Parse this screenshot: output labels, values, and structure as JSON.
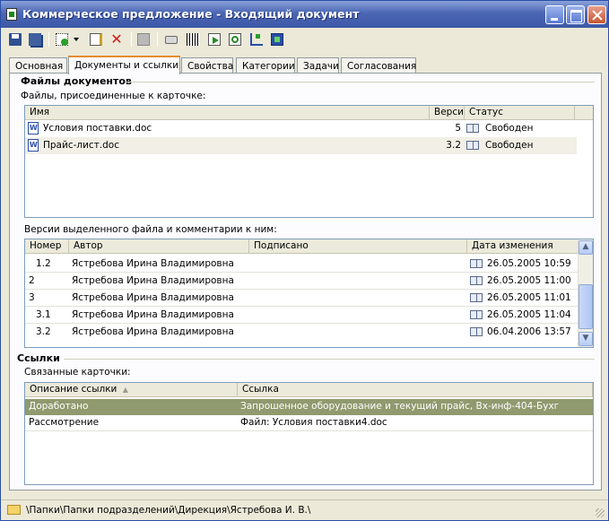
{
  "window": {
    "title": "Коммерческое предложение - Входящий документ",
    "titlebar_buttons": [
      "minimize",
      "maximize",
      "close"
    ]
  },
  "toolbar": {
    "icons": [
      "save-icon",
      "save-all-icon",
      "new-document-icon",
      "dropdown-arrow-icon",
      "properties-icon",
      "delete-icon",
      "sign-icon",
      "print-icon",
      "barcode-icon",
      "export-icon",
      "refresh-icon",
      "structure-icon",
      "workflow-icon"
    ]
  },
  "tabs": [
    {
      "label": "Основная"
    },
    {
      "label": "Документы и ссылки",
      "active": true
    },
    {
      "label": "Свойства"
    },
    {
      "label": "Категории"
    },
    {
      "label": "Задачи"
    },
    {
      "label": "Согласования"
    }
  ],
  "files_section": {
    "title": "Файлы документов",
    "label": "Файлы, присоединенные к карточке:",
    "columns": [
      "Имя",
      "Версия",
      "Статус"
    ],
    "rows": [
      {
        "name": "Условия поставки.doc",
        "version": "5",
        "status": "Свободен"
      },
      {
        "name": "Прайс-лист.doc",
        "version": "3.2",
        "status": "Свободен",
        "selected": true
      }
    ]
  },
  "versions_section": {
    "label": "Версии выделенного файла и комментарии к ним:",
    "columns": [
      "Номер",
      "Автор",
      "Подписано",
      "Дата изменения"
    ],
    "rows": [
      {
        "number": "1.2",
        "author": "Ястребова Ирина Владимировна",
        "signed": "",
        "date": "26.05.2005 10:59"
      },
      {
        "number": "2",
        "author": "Ястребова Ирина Владимировна",
        "signed": "",
        "date": "26.05.2005 11:00"
      },
      {
        "number": "3",
        "author": "Ястребова Ирина Владимировна",
        "signed": "",
        "date": "26.05.2005 11:01"
      },
      {
        "number": "3.1",
        "author": "Ястребова Ирина Владимировна",
        "signed": "",
        "date": "26.05.2005 11:04"
      },
      {
        "number": "3.2",
        "author": "Ястребова Ирина Владимировна",
        "signed": "",
        "date": "06.04.2006 13:57"
      }
    ]
  },
  "links_section": {
    "title": "Ссылки",
    "label": "Связанные карточки:",
    "columns": [
      "Описание ссылки",
      "Ссылка"
    ],
    "sort_indicator": "▲",
    "rows": [
      {
        "description": "Доработано",
        "link": "Запрошенное оборудование и текущий прайс, Вх-инф-404-Бухг",
        "selected": true
      },
      {
        "description": "Рассмотрение",
        "link": "Файл: Условия поставки4.doc"
      }
    ]
  },
  "statusbar": {
    "path": "\\Папки\\Папки подразделений\\Дирекция\\Ястребова И. В.\\"
  },
  "colors": {
    "titlebar": "#3d58a6",
    "selection_gray": "#f1efe6",
    "selection_olive": "#8f9a6e",
    "active_tab_accent": "#e68b2c"
  }
}
